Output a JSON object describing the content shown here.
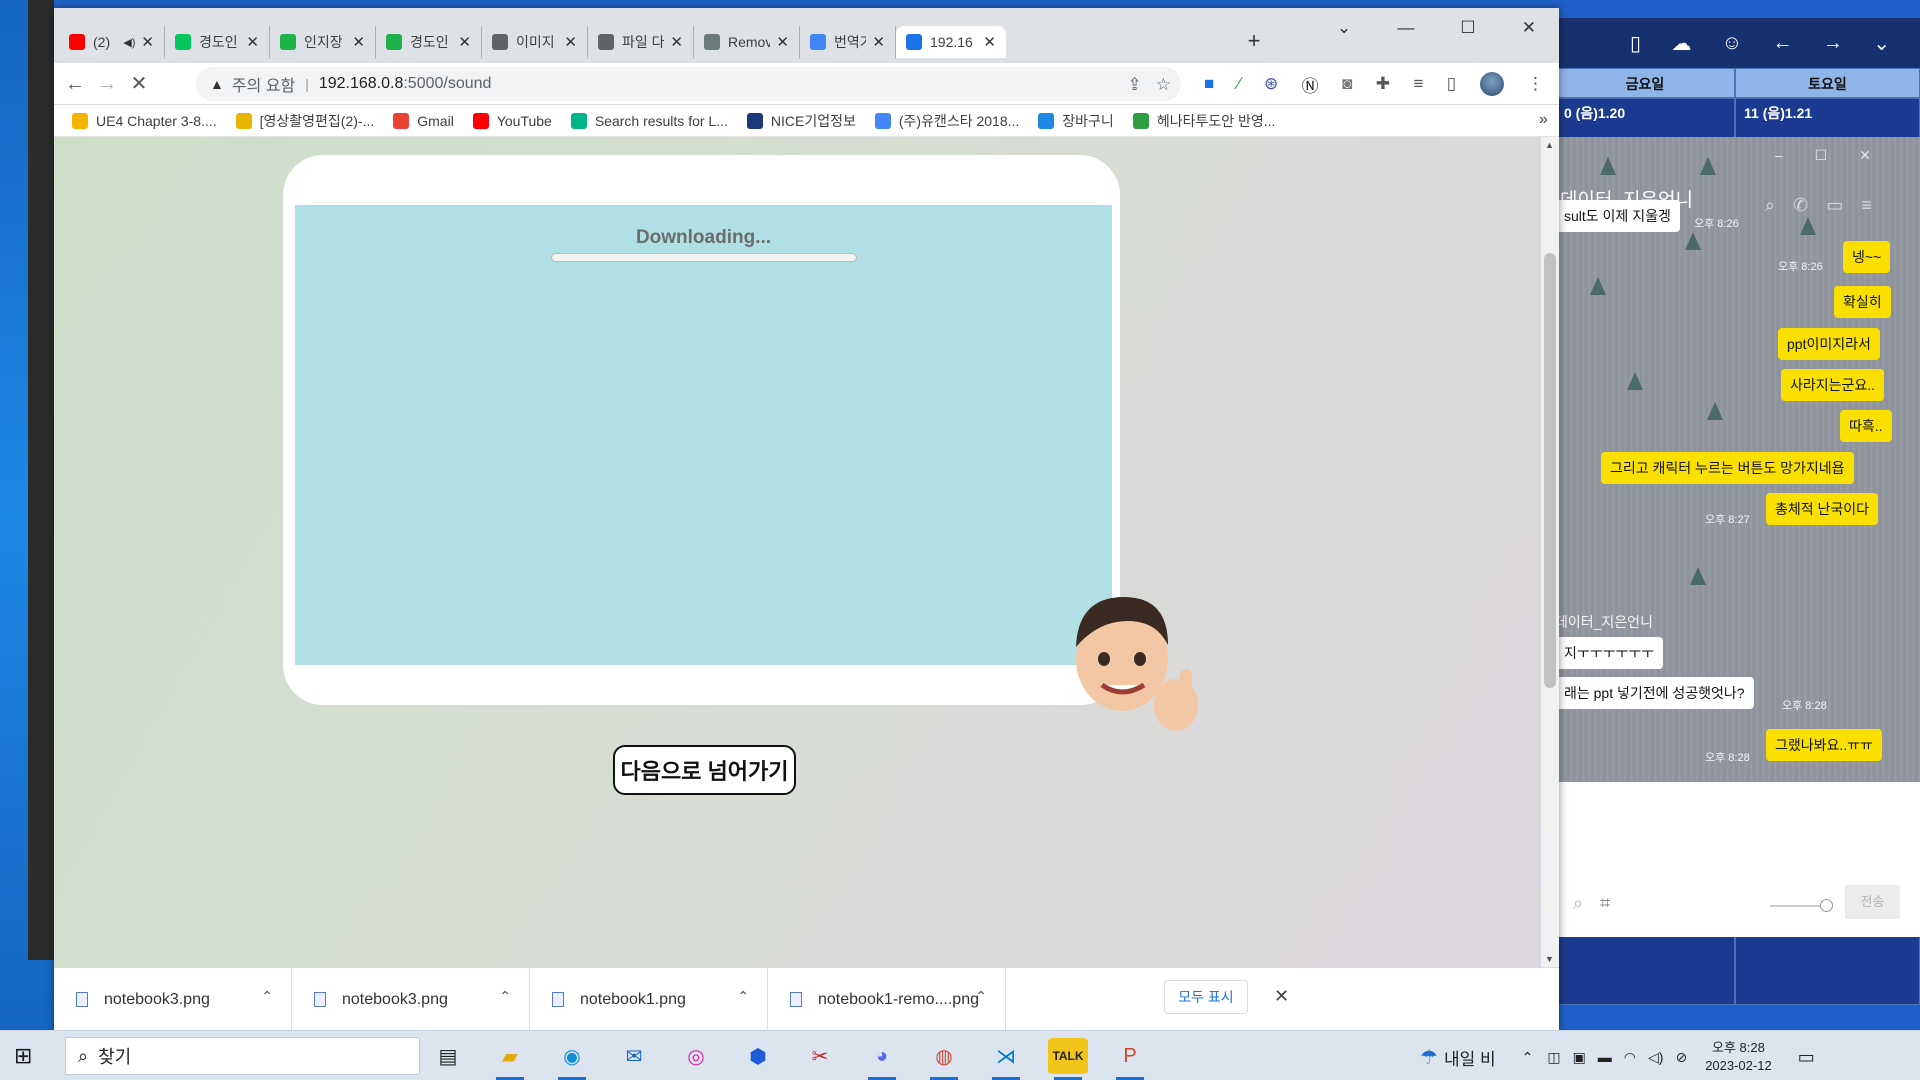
{
  "browser": {
    "tabs": [
      {
        "label": "(2)",
        "icon": "youtube-icon",
        "color": "#ff0000",
        "muted_icon": "speaker-icon"
      },
      {
        "label": "경도인",
        "icon": "naver-icon",
        "color": "#03c75a"
      },
      {
        "label": "인지장",
        "icon": "green-doc-icon",
        "color": "#1fb24a"
      },
      {
        "label": "경도인",
        "icon": "green-doc-icon",
        "color": "#1fb24a"
      },
      {
        "label": "이미지",
        "icon": "layers-icon",
        "color": "#5f6368"
      },
      {
        "label": "파일 다",
        "icon": "globe-icon",
        "color": "#5f6368"
      },
      {
        "label": "Remov",
        "icon": "openai-icon",
        "color": "#6b7b78"
      },
      {
        "label": "번역기",
        "icon": "google-icon",
        "color": "#4285f4"
      },
      {
        "label": "192.16",
        "icon": "loading-icon",
        "color": "#1a73e8",
        "active": true
      }
    ],
    "address": {
      "security_label": "주의 요함",
      "host": "192.168.0.8",
      "path": ":5000/sound"
    },
    "bookmarks": [
      {
        "label": "UE4 Chapter 3-8....",
        "color": "#f4b400"
      },
      {
        "label": "[영상촬영편집(2)-...",
        "color": "#e8b600"
      },
      {
        "label": "Gmail",
        "color": "#ea4335"
      },
      {
        "label": "YouTube",
        "color": "#ff0000"
      },
      {
        "label": "Search results for L...",
        "color": "#00b489"
      },
      {
        "label": "NICE기업정보",
        "color": "#1b3a7a"
      },
      {
        "label": "(주)유캔스타 2018...",
        "color": "#4285f4"
      },
      {
        "label": "장바구니",
        "color": "#1e88e5"
      },
      {
        "label": "헤나타투도안 반영...",
        "color": "#2e9e3e"
      }
    ],
    "more_label": "»"
  },
  "page": {
    "status_text": "Downloading...",
    "progress": 0,
    "next_button": "다음으로 넘어가기"
  },
  "downloads": {
    "items": [
      "notebook3.png",
      "notebook3.png",
      "notebook1.png",
      "notebook1-remo....png"
    ],
    "show_all": "모두 표시"
  },
  "right_calendar": {
    "headers": [
      "금요일",
      "토요일"
    ],
    "cells": [
      "0 (음)1.20",
      "11 (음)1.21"
    ]
  },
  "chat": {
    "title": "데이터_지은언니",
    "sender_label": "데이터_지은언니",
    "send_label": "전송",
    "messages": [
      {
        "text": "sult도 이제 지울겡",
        "side": "you",
        "time": "오후 8:26"
      },
      {
        "text": "넹~~",
        "side": "me",
        "time": "오후 8:26"
      },
      {
        "text": "확실히",
        "side": "me",
        "time": ""
      },
      {
        "text": "ppt이미지라서",
        "side": "me",
        "time": ""
      },
      {
        "text": "사라지는군요..",
        "side": "me",
        "time": ""
      },
      {
        "text": "따흑..",
        "side": "me",
        "time": ""
      },
      {
        "text": "그리고 캐릭터 누르는 버튼도 망가지네욥",
        "side": "me",
        "time": ""
      },
      {
        "text": "총체적 난국이다",
        "side": "me",
        "time": "오후 8:27"
      },
      {
        "text": "지ㅜㅜㅜㅜㅜㅜ",
        "side": "you",
        "time": ""
      },
      {
        "text": "래는 ppt 넣기전에 성공햇엇나?",
        "side": "you",
        "time": "오후 8:28"
      },
      {
        "text": "그랬나봐요..ㅠㅠ",
        "side": "me",
        "time": "오후 8:28"
      }
    ]
  },
  "taskbar": {
    "search_placeholder": "찾기",
    "weather": "내일 비",
    "time": "오후 8:28",
    "date": "2023-02-12",
    "apps": [
      "task-view-icon",
      "file-explorer-icon",
      "edge-icon",
      "mail-icon",
      "instagram-icon",
      "app-blue-icon",
      "snip-icon",
      "discord-icon",
      "chrome-icon",
      "vscode-icon",
      "kakaotalk-icon",
      "powerpoint-icon"
    ]
  }
}
